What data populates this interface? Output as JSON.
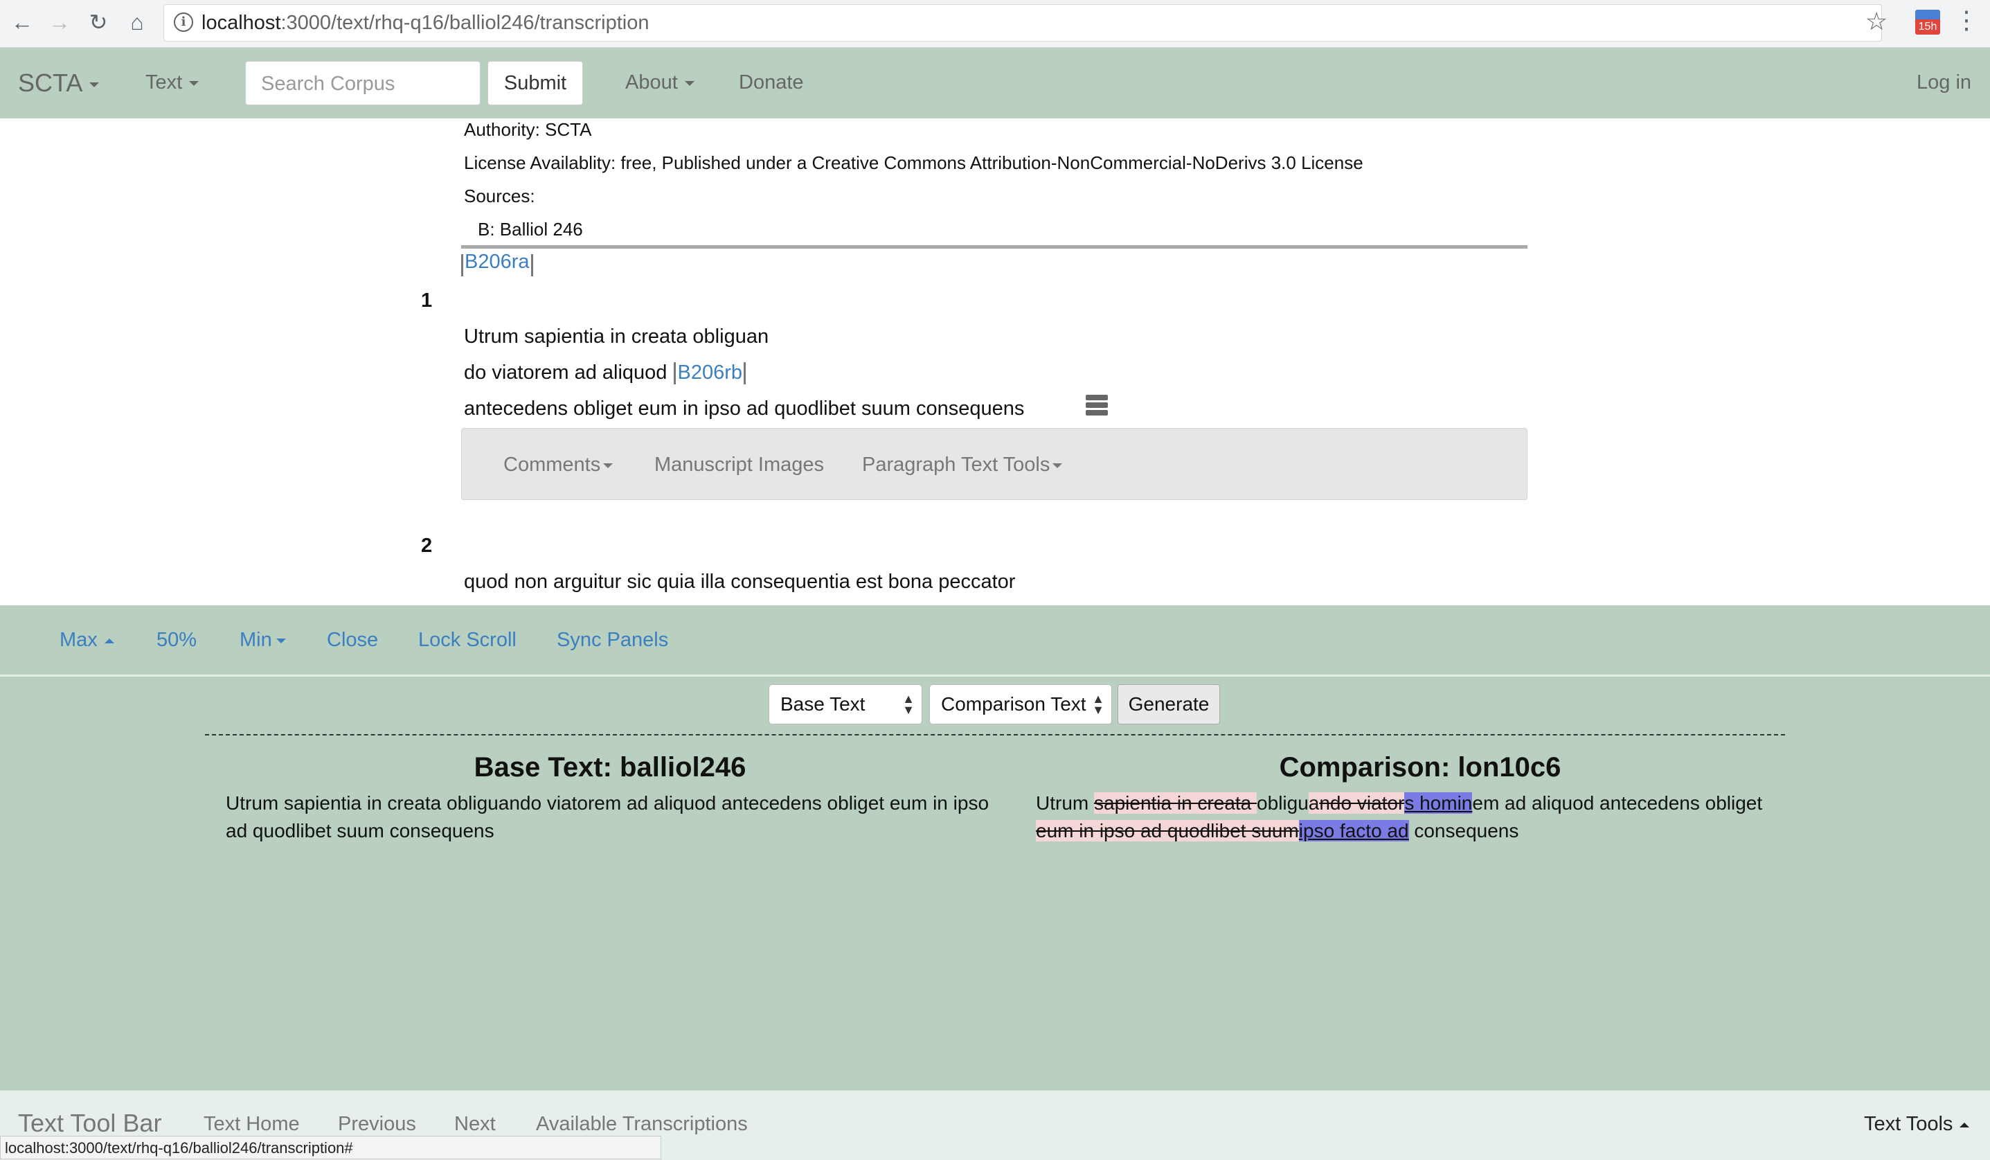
{
  "browser": {
    "url_host": "localhost",
    "url_rest": ":3000/text/rhq-q16/balliol246/transcription",
    "extension_badge": "15h",
    "status_url": "localhost:3000/text/rhq-q16/balliol246/transcription#"
  },
  "navbar": {
    "brand": "SCTA",
    "text_menu": "Text",
    "search_placeholder": "Search Corpus",
    "submit": "Submit",
    "about": "About",
    "donate": "Donate",
    "login": "Log in"
  },
  "metadata": {
    "authority": "Authority: SCTA",
    "license": "License Availablity: free, Published under a Creative Commons Attribution-NonCommercial-NoDerivs 3.0 License",
    "sources_label": "Sources:",
    "source_b": "B: Balliol 246"
  },
  "content": {
    "pb1": "B206ra",
    "para1_number": "1",
    "para1_line1": "Utrum sapientia in creata obliguan",
    "para1_line2": "do viatorem ad aliquod",
    "pb2": "B206rb",
    "para1_line3": "antecedens obliget eum in ipso ad quodlibet suum consequens",
    "tools": {
      "comments": "Comments",
      "manuscript_images": "Manuscript Images",
      "paragraph_text_tools": "Paragraph Text Tools"
    },
    "para2_number": "2",
    "para2_line1": "quod non arguitur sic quia illa consequentia est bona peccator"
  },
  "panel": {
    "controls": {
      "max": "Max",
      "fifty": "50%",
      "min": "Min",
      "close": "Close",
      "lock_scroll": "Lock Scroll",
      "sync_panels": "Sync Panels"
    },
    "base_select": "Base Text",
    "comparison_select": "Comparison Text",
    "generate": "Generate",
    "base_title": "Base Text: balliol246",
    "base_body": "Utrum sapientia in creata obliguando viatorem ad aliquod antecedens obliget eum in ipso ad quodlibet suum consequens",
    "comparison_title": "Comparison: lon10c6",
    "comparison_segments": {
      "s1": "Utrum ",
      "s2": "sapientia in creata ",
      "s3": "obligu",
      "s4": "a",
      "s5": "ndo viator",
      "s6": "s homin",
      "s7": "em ad aliquod antecedens obliget ",
      "s8": "eum in ipso ad quodlibet suum",
      "s9": "ipso facto ad",
      "s10": " consequens"
    }
  },
  "bottom_toolbar": {
    "brand": "Text Tool Bar",
    "text_home": "Text Home",
    "previous": "Previous",
    "next": "Next",
    "available_transcriptions": "Available Transcriptions",
    "text_tools": "Text Tools"
  }
}
